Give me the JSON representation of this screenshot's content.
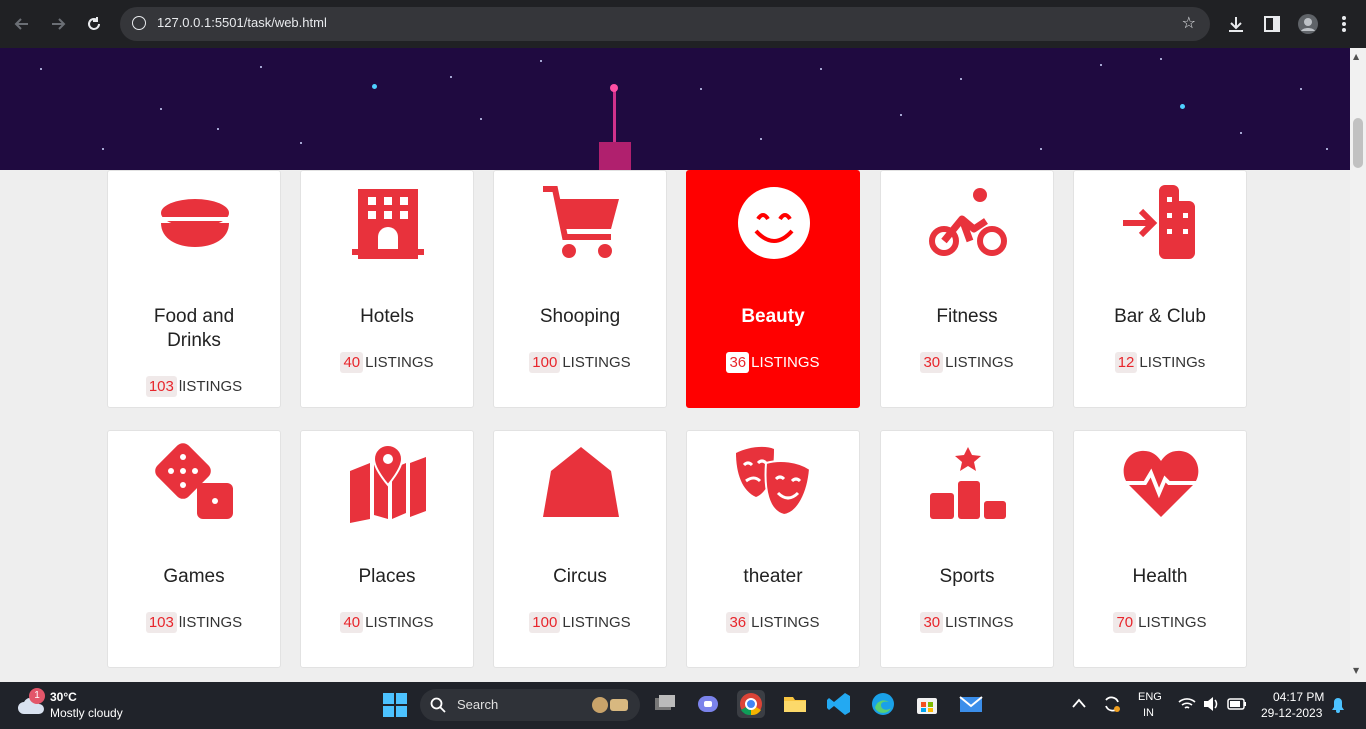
{
  "browser": {
    "url": "127.0.0.1:5501/task/web.html"
  },
  "categories_row1": [
    {
      "title_lines": [
        "Food and",
        "Drinks"
      ],
      "count": "103",
      "label": "lISTINGS",
      "icon": "food-bowl-icon",
      "active": false
    },
    {
      "title_lines": [
        "Hotels"
      ],
      "count": "40",
      "label": "LISTINGS",
      "icon": "hotel-icon",
      "active": false
    },
    {
      "title_lines": [
        "Shooping"
      ],
      "count": "100",
      "label": "LISTINGS",
      "icon": "shopping-cart-icon",
      "active": false
    },
    {
      "title_lines": [
        "Beauty"
      ],
      "count": "36",
      "label": "LISTINGS",
      "icon": "smile-icon",
      "active": true
    },
    {
      "title_lines": [
        "Fitness"
      ],
      "count": "30",
      "label": "LISTINGS",
      "icon": "bicycle-icon",
      "active": false
    },
    {
      "title_lines": [
        "Bar & Club"
      ],
      "count": "12",
      "label": "LISTINGs",
      "icon": "building-enter-icon",
      "active": false
    }
  ],
  "categories_row2": [
    {
      "title_lines": [
        "Games"
      ],
      "count": "103",
      "label": "lISTINGS",
      "icon": "dice-icon",
      "active": false
    },
    {
      "title_lines": [
        "Places"
      ],
      "count": "40",
      "label": "LISTINGS",
      "icon": "map-pin-icon",
      "active": false
    },
    {
      "title_lines": [
        "Circus"
      ],
      "count": "100",
      "label": "LISTINGS",
      "icon": "tent-icon",
      "active": false
    },
    {
      "title_lines": [
        "theater"
      ],
      "count": "36",
      "label": "LISTINGS",
      "icon": "masks-icon",
      "active": false
    },
    {
      "title_lines": [
        "Sports"
      ],
      "count": "30",
      "label": "LISTINGS",
      "icon": "podium-icon",
      "active": false
    },
    {
      "title_lines": [
        "Health"
      ],
      "count": "70",
      "label": "LISTINGS",
      "icon": "heart-pulse-icon",
      "active": false
    }
  ],
  "colors": {
    "accent": "#e8323c",
    "active_card": "#ff0000",
    "hero_bg": "#1f0a40"
  },
  "taskbar": {
    "weather_badge": "1",
    "temperature": "30°C",
    "weather": "Mostly cloudy",
    "search_placeholder": "Search",
    "lang_top": "ENG",
    "lang_bottom": "IN",
    "time": "04:17 PM",
    "date": "29-12-2023"
  }
}
